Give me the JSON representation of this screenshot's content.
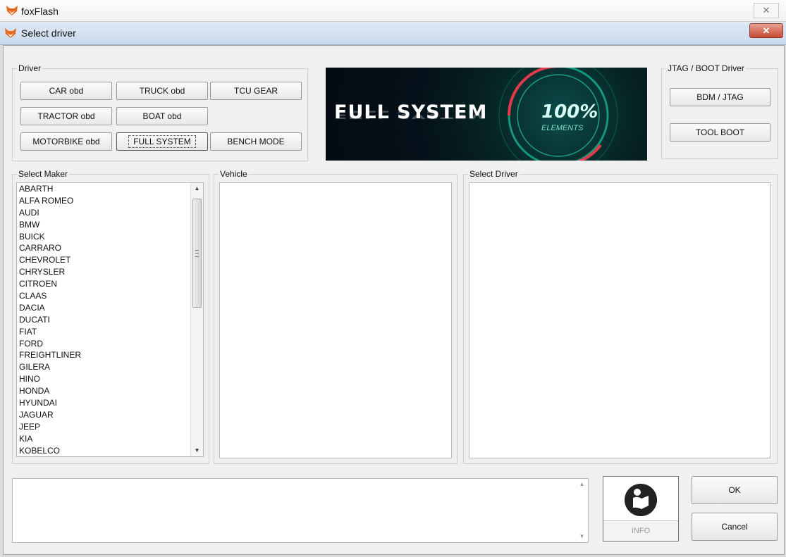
{
  "app": {
    "title": "foxFlash"
  },
  "dialog": {
    "title": "Select driver"
  },
  "driver_group": {
    "legend": "Driver",
    "buttons": [
      "CAR  obd",
      "TRUCK  obd",
      "TCU GEAR",
      "TRACTOR  obd",
      "BOAT  obd",
      "MOTORBIKE  obd",
      "FULL SYSTEM",
      "BENCH MODE"
    ]
  },
  "banner": {
    "headline": "FULL SYSTEM",
    "percent": "100%",
    "caption": "ELEMENTS"
  },
  "jtag_group": {
    "legend": "JTAG / BOOT Driver",
    "bdm_label": "BDM / JTAG",
    "tool_boot_label": "TOOL BOOT"
  },
  "maker_group": {
    "legend": "Select Maker",
    "items": [
      "ABARTH",
      "ALFA ROMEO",
      "AUDI",
      "BMW",
      "BUICK",
      "CARRARO",
      "CHEVROLET",
      "CHRYSLER",
      "CITROEN",
      "CLAAS",
      "DACIA",
      "DUCATI",
      "FIAT",
      "FORD",
      "FREIGHTLINER",
      "GILERA",
      "HINO",
      "HONDA",
      "HYUNDAI",
      "JAGUAR",
      "JEEP",
      "KIA",
      "KOBELCO"
    ]
  },
  "vehicle_group": {
    "legend": "Vehicle"
  },
  "select_driver_group": {
    "legend": "Select Driver"
  },
  "info": {
    "label": "INFO"
  },
  "actions": {
    "ok_label": "OK",
    "cancel_label": "Cancel"
  },
  "icons": {
    "app": "fox-logo-icon",
    "close": "close-icon",
    "info": "reader-icon"
  },
  "colors": {
    "dialog_title_bg": "#c9d9ec",
    "close_button": "#c74a34",
    "banner_bg": "#05111a"
  }
}
